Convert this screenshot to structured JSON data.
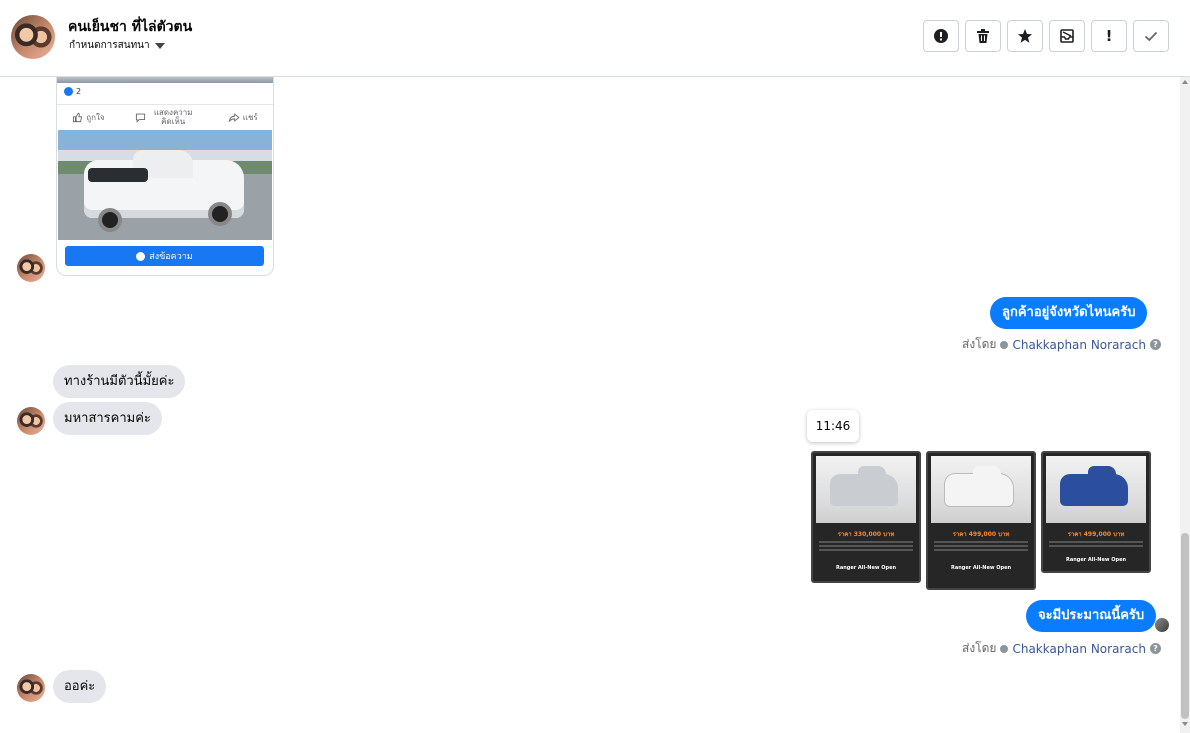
{
  "header": {
    "title": "คนเย็นชา ที่ไล่ตัวตน",
    "subtitle": "กำหนดการสนทนา"
  },
  "toolbar": {
    "icons": [
      "alert-icon",
      "trash-icon",
      "star-icon",
      "archive-icon",
      "exclamation-icon",
      "check-icon"
    ],
    "exclamation_label": "!"
  },
  "post_card": {
    "likes_count": "2",
    "like_label": "ถูกใจ",
    "comment_label": "แสดงความคิดเห็น",
    "share_label": "แชร์",
    "send_message_label": "ส่งข้อความ"
  },
  "messages": {
    "out_1": "ลูกค้าอยู่จังหวัดไหนครับ",
    "in_1": "ทางร้านมีตัวนี้มั้ยค่ะ",
    "in_2": "มหาสารคามค่ะ",
    "tooltip_time": "11:46",
    "out_2": "จะมีประมาณนี้ครับ",
    "in_3": "ออค่ะ"
  },
  "sent_by": {
    "prefix": "ส่งโดย",
    "name": "Chakkaphan Norarach",
    "help": "?"
  },
  "listings": [
    {
      "price": "ราคา 330,000 บาท",
      "model": "Ranger All-New Open",
      "car_color": "#c9ccd0"
    },
    {
      "price": "ราคา 499,000 บาท",
      "model": "Ranger All-New Open",
      "car_color": "#f4f4f4"
    },
    {
      "price": "ราคา 499,000 บาท",
      "model": "Ranger All-New Open",
      "car_color": "#2b4f9e"
    }
  ],
  "colors": {
    "accent": "#0a7cff",
    "facebook_blue": "#1877f2",
    "incoming_bubble": "#e4e6eb",
    "listing_price": "#ff8a2a"
  }
}
